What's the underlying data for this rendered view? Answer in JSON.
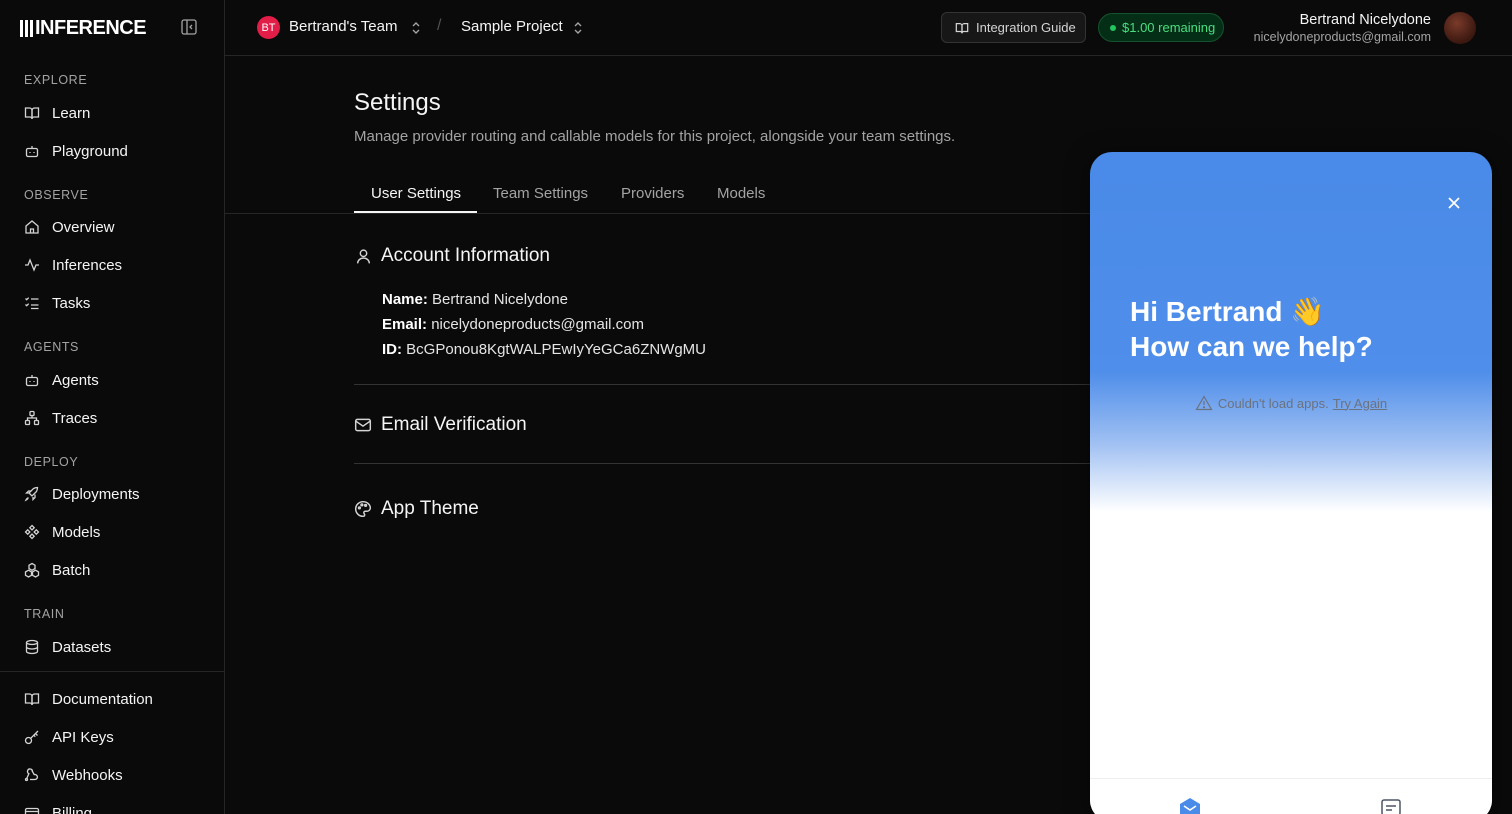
{
  "brand": {
    "name": "INFERENCE"
  },
  "sidebar": {
    "sections": [
      {
        "title": "EXPLORE",
        "items": [
          {
            "label": "Learn",
            "icon": "book-icon"
          },
          {
            "label": "Playground",
            "icon": "bot-icon"
          }
        ]
      },
      {
        "title": "OBSERVE",
        "items": [
          {
            "label": "Overview",
            "icon": "home-icon"
          },
          {
            "label": "Inferences",
            "icon": "activity-icon"
          },
          {
            "label": "Tasks",
            "icon": "list-checks-icon"
          }
        ]
      },
      {
        "title": "AGENTS",
        "items": [
          {
            "label": "Agents",
            "icon": "bot-icon"
          },
          {
            "label": "Traces",
            "icon": "network-icon"
          }
        ]
      },
      {
        "title": "DEPLOY",
        "items": [
          {
            "label": "Deployments",
            "icon": "rocket-icon"
          },
          {
            "label": "Models",
            "icon": "diamond-grid-icon"
          },
          {
            "label": "Batch",
            "icon": "boxes-icon"
          }
        ]
      },
      {
        "title": "TRAIN",
        "items": [
          {
            "label": "Datasets",
            "icon": "database-icon"
          }
        ]
      }
    ],
    "footer_items": [
      {
        "label": "Documentation",
        "icon": "book-icon"
      },
      {
        "label": "API Keys",
        "icon": "key-icon"
      },
      {
        "label": "Webhooks",
        "icon": "webhook-icon"
      },
      {
        "label": "Billing",
        "icon": "credit-card-icon"
      }
    ]
  },
  "topbar": {
    "team_initials": "BT",
    "team_name": "Bertrand's Team",
    "separator": "/",
    "project_name": "Sample Project",
    "integration_guide": "Integration Guide",
    "credit": "$1.00 remaining",
    "user_name": "Bertrand Nicelydone",
    "user_email": "nicelydoneproducts@gmail.com"
  },
  "main": {
    "title": "Settings",
    "subtitle": "Manage provider routing and callable models for this project, alongside your team settings.",
    "tabs": [
      {
        "label": "User Settings",
        "active": true
      },
      {
        "label": "Team Settings"
      },
      {
        "label": "Providers"
      },
      {
        "label": "Models"
      }
    ],
    "account": {
      "heading": "Account Information",
      "name_label": "Name:",
      "name_value": "Bertrand Nicelydone",
      "email_label": "Email:",
      "email_value": "nicelydoneproducts@gmail.com",
      "id_label": "ID:",
      "id_value": "BcGPonou8KgtWALPEwIyYeGCa6ZNWgMU"
    },
    "email_verification": {
      "heading": "Email Verification"
    },
    "app_theme": {
      "heading": "App Theme"
    }
  },
  "help_widget": {
    "greeting_line1": "Hi Bertrand 👋",
    "greeting_line2": "How can we help?",
    "error_text": "Couldn't load apps.",
    "retry": "Try Again"
  },
  "colors": {
    "accent_blue": "#4a8ae8",
    "credit_green": "#4ade80",
    "team_avatar": "#e11d48"
  }
}
